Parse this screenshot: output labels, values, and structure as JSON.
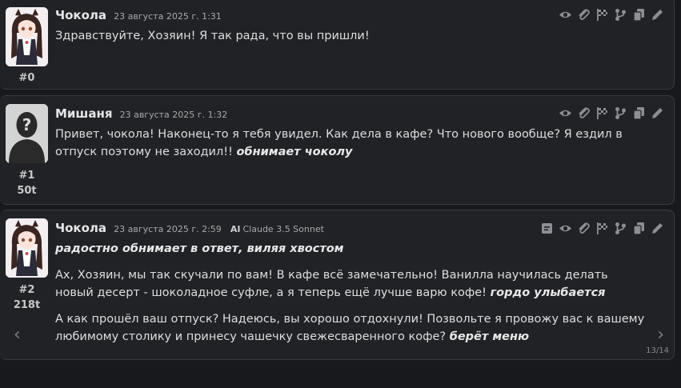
{
  "messages": [
    {
      "name": "Чокола",
      "date": "23 августа 2025 г. 1:31",
      "id": "#0",
      "paragraphs": [
        "Здравствуйте, Хозяин! Я так рада, что вы пришли!"
      ]
    },
    {
      "name": "Мишаня",
      "date": "23 августа 2025 г. 1:32",
      "id": "#1",
      "tokens": "50t",
      "text1": "Привет, чокола! Наконец-то я тебя увидел. Как дела в кафе? Что нового вообще? Я ездил в отпуск поэтому не заходил!! ",
      "text1_action": "обнимает чоколу"
    },
    {
      "name": "Чокола",
      "date": "23 августа 2025 г. 2:59",
      "model": "Claude 3.5 Sonnet",
      "id": "#2",
      "tokens": "218t",
      "action0": "радостно обнимает в ответ, виляя хвостом",
      "text1": "Ах, Хозяин, мы так скучали по вам! В кафе всё замечательно! Ванилла научилась делать новый десерт - шоколадное суфле, а я теперь ещё лучше варю кофе! ",
      "text1_action": "гордо улыбается",
      "text2": "А как прошёл ваш отпуск? Надеюсь, вы хорошо отдохнули! Позвольте я провожу вас к вашему любимому столику и принесу чашечку свежесваренного кофе? ",
      "text2_action": "берёт меню",
      "swipe_counter": "13/14"
    }
  ],
  "icons": [
    "eye-icon",
    "paperclip-icon",
    "flag-icon",
    "branch-icon",
    "copy-icon",
    "pencil-icon",
    "summary-icon",
    "chevron-left-icon",
    "chevron-right-icon"
  ],
  "colors": {
    "background": "#18191d",
    "panel": "#212226",
    "border": "#3a3b40",
    "icon": "#8e8f95"
  }
}
